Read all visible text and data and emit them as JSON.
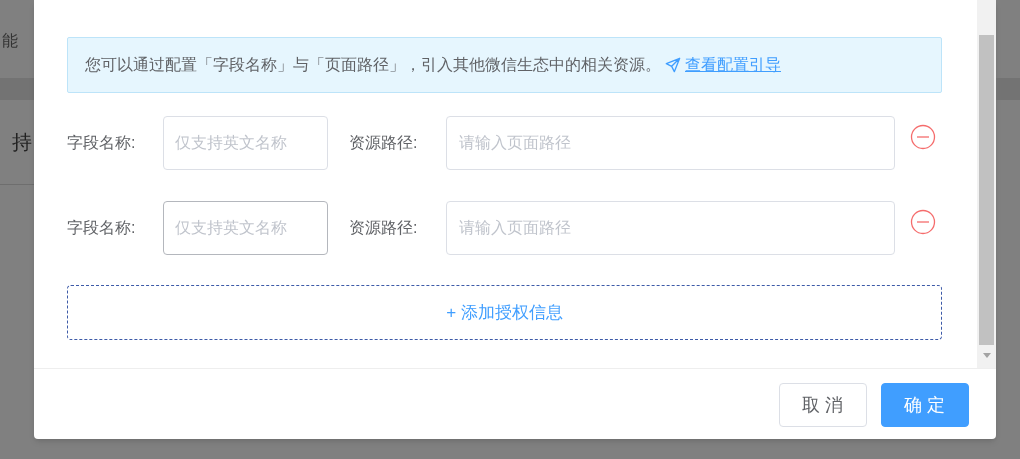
{
  "background": {
    "texts": [
      "能",
      "持"
    ]
  },
  "notice": {
    "text": "您可以通过配置「字段名称」与「页面路径」，引入其他微信生态中的相关资源。",
    "link": "查看配置引导"
  },
  "rows": [
    {
      "field_label": "字段名称:",
      "field_placeholder": "仅支持英文名称",
      "field_focused": false,
      "path_label": "资源路径:",
      "path_placeholder": "请输入页面路径"
    },
    {
      "field_label": "字段名称:",
      "field_placeholder": "仅支持英文名称",
      "field_focused": true,
      "path_label": "资源路径:",
      "path_placeholder": "请输入页面路径"
    }
  ],
  "add_button": "+ 添加授权信息",
  "footer": {
    "buttons": [
      {
        "label": "取 消",
        "kind": "secondary"
      },
      {
        "label": "确 定",
        "kind": "primary"
      }
    ]
  }
}
